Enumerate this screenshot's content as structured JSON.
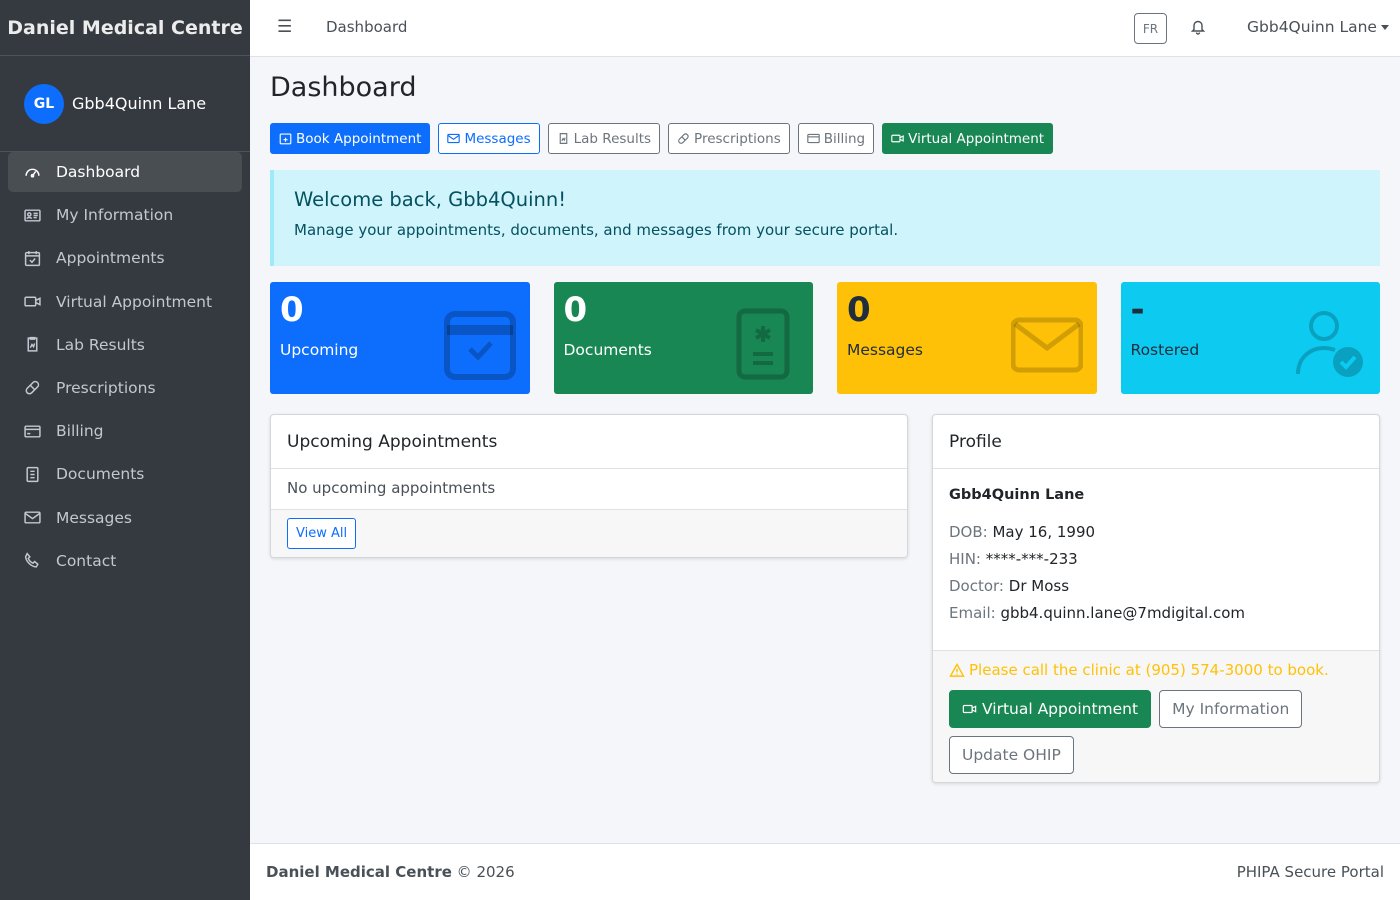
{
  "brand": "Daniel Medical Centre",
  "user": {
    "initials": "GL",
    "name": "Gbb4Quinn Lane"
  },
  "sidebar": {
    "items": [
      {
        "label": "Dashboard",
        "icon": "gauge-icon",
        "active": true
      },
      {
        "label": "My Information",
        "icon": "id-card-icon"
      },
      {
        "label": "Appointments",
        "icon": "calendar-check-icon"
      },
      {
        "label": "Virtual Appointment",
        "icon": "camera-video-icon"
      },
      {
        "label": "Lab Results",
        "icon": "lab-report-icon"
      },
      {
        "label": "Prescriptions",
        "icon": "capsule-icon"
      },
      {
        "label": "Billing",
        "icon": "credit-card-icon"
      },
      {
        "label": "Documents",
        "icon": "document-icon"
      },
      {
        "label": "Messages",
        "icon": "envelope-icon"
      },
      {
        "label": "Contact",
        "icon": "phone-icon"
      }
    ]
  },
  "navbar": {
    "title": "Dashboard",
    "lang": "FR",
    "user_name": "Gbb4Quinn Lane"
  },
  "page": {
    "title": "Dashboard",
    "quick_actions": {
      "book": "Book Appointment",
      "messages": "Messages",
      "lab": "Lab Results",
      "prescriptions": "Prescriptions",
      "billing": "Billing",
      "virtual": "Virtual Appointment"
    },
    "welcome": {
      "title": "Welcome back, Gbb4Quinn!",
      "text": "Manage your appointments, documents, and messages from your secure portal."
    },
    "stats": [
      {
        "value": "0",
        "label": "Upcoming",
        "color": "#0d6efd"
      },
      {
        "value": "0",
        "label": "Documents",
        "color": "#198754"
      },
      {
        "value": "0",
        "label": "Messages",
        "color": "#ffc107"
      },
      {
        "value": "-",
        "label": "Rostered",
        "color": "#0dcaf0"
      }
    ],
    "upcoming": {
      "title": "Upcoming Appointments",
      "empty": "No upcoming appointments",
      "view_all": "View All"
    },
    "profile": {
      "title": "Profile",
      "name": "Gbb4Quinn Lane",
      "dob_label": "DOB:",
      "dob": "May 16, 1990",
      "hin_label": "HIN:",
      "hin": "****-***-233",
      "doctor_label": "Doctor:",
      "doctor": "Dr Moss",
      "email_label": "Email:",
      "email": "gbb4.quinn.lane@7mdigital.com",
      "warning": "Please call the clinic at (905) 574-3000 to book.",
      "virtual_btn": "Virtual Appointment",
      "info_btn": "My Information",
      "ohip_btn": "Update OHIP"
    }
  },
  "footer": {
    "brand": "Daniel Medical Centre",
    "copyright": "© 2026",
    "right": "PHIPA Secure Portal"
  }
}
